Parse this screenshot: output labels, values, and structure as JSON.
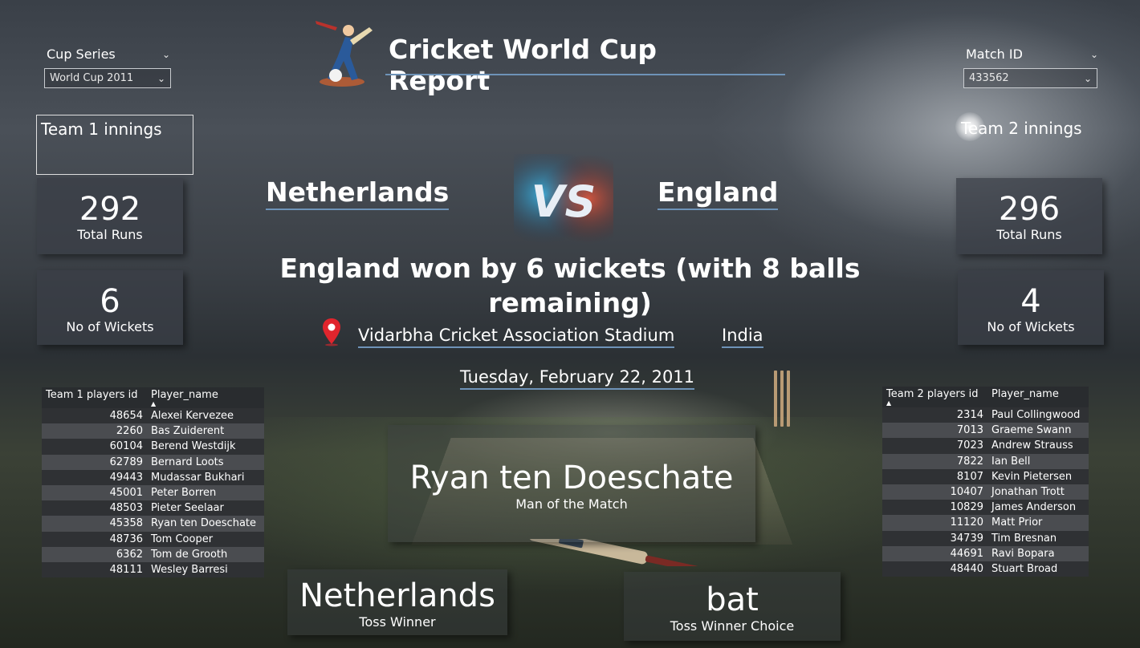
{
  "header": {
    "title": "Cricket World Cup Report"
  },
  "slicers": {
    "cup_series": {
      "label": "Cup Series",
      "value": "World Cup 2011"
    },
    "match_id": {
      "label": "Match ID",
      "value": "433562"
    }
  },
  "team1": {
    "innings_label": "Team 1 innings",
    "name": "Netherlands",
    "total_runs": "292",
    "total_runs_label": "Total Runs",
    "wickets": "6",
    "wickets_label": "No of Wickets",
    "table": {
      "columns": [
        "Team 1 players id",
        "Player_name"
      ],
      "rows": [
        [
          "48654",
          "Alexei Kervezee"
        ],
        [
          "2260",
          "Bas Zuiderent"
        ],
        [
          "60104",
          "Berend Westdijk"
        ],
        [
          "62789",
          "Bernard Loots"
        ],
        [
          "49443",
          "Mudassar Bukhari"
        ],
        [
          "45001",
          "Peter Borren"
        ],
        [
          "48503",
          "Pieter Seelaar"
        ],
        [
          "45358",
          "Ryan ten Doeschate"
        ],
        [
          "48736",
          "Tom Cooper"
        ],
        [
          "6362",
          "Tom de Grooth"
        ],
        [
          "48111",
          "Wesley Barresi"
        ]
      ]
    }
  },
  "team2": {
    "innings_label": "Team 2 innings",
    "name": "England",
    "total_runs": "296",
    "total_runs_label": "Total Runs",
    "wickets": "4",
    "wickets_label": "No of Wickets",
    "table": {
      "columns": [
        "Team 2 players id",
        "Player_name"
      ],
      "rows": [
        [
          "2314",
          "Paul Collingwood"
        ],
        [
          "7013",
          "Graeme Swann"
        ],
        [
          "7023",
          "Andrew Strauss"
        ],
        [
          "7822",
          "Ian Bell"
        ],
        [
          "8107",
          "Kevin Pietersen"
        ],
        [
          "10407",
          "Jonathan Trott"
        ],
        [
          "10829",
          "James Anderson"
        ],
        [
          "11120",
          "Matt Prior"
        ],
        [
          "34739",
          "Tim Bresnan"
        ],
        [
          "44691",
          "Ravi Bopara"
        ],
        [
          "48440",
          "Stuart Broad"
        ]
      ]
    }
  },
  "match": {
    "vs_text": "VS",
    "result": "England won by 6 wickets (with 8 balls remaining)",
    "venue": "Vidarbha Cricket Association Stadium",
    "country": "India",
    "date": "Tuesday, February 22, 2011",
    "man_of_match": {
      "name": "Ryan ten Doeschate",
      "label": "Man of the Match"
    },
    "toss_winner": {
      "value": "Netherlands",
      "label": "Toss Winner"
    },
    "toss_choice": {
      "value": "bat",
      "label": "Toss Winner Choice"
    }
  },
  "colors": {
    "accent_underline": "#6e93b8",
    "pin": "#e0252d"
  },
  "icons": [
    "batsman-logo-icon",
    "vs-icon",
    "location-pin-icon",
    "chevron-down-icon"
  ]
}
